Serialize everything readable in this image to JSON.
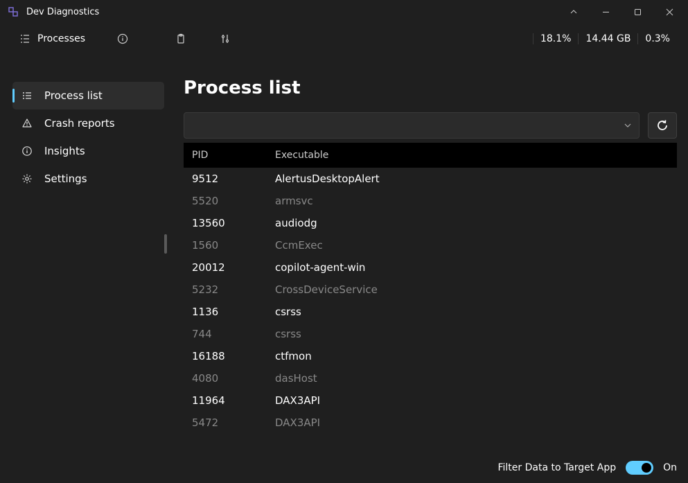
{
  "window": {
    "title": "Dev Diagnostics"
  },
  "toolbar": {
    "processes_label": "Processes"
  },
  "stats": {
    "cpu": "18.1%",
    "memory": "14.44 GB",
    "other": "0.3%"
  },
  "sidebar": {
    "items": [
      {
        "label": "Process list",
        "icon": "list-icon",
        "active": true
      },
      {
        "label": "Crash reports",
        "icon": "warning-icon",
        "active": false
      },
      {
        "label": "Insights",
        "icon": "info-icon",
        "active": false
      },
      {
        "label": "Settings",
        "icon": "gear-icon",
        "active": false
      }
    ]
  },
  "main": {
    "title": "Process list",
    "search_value": "",
    "headers": {
      "pid": "PID",
      "exe": "Executable"
    },
    "rows": [
      {
        "pid": "9512",
        "exe": "AlertusDesktopAlert",
        "dim": false
      },
      {
        "pid": "5520",
        "exe": "armsvc",
        "dim": true
      },
      {
        "pid": "13560",
        "exe": "audiodg",
        "dim": false
      },
      {
        "pid": "1560",
        "exe": "CcmExec",
        "dim": true
      },
      {
        "pid": "20012",
        "exe": "copilot-agent-win",
        "dim": false
      },
      {
        "pid": "5232",
        "exe": "CrossDeviceService",
        "dim": true
      },
      {
        "pid": "1136",
        "exe": "csrss",
        "dim": false
      },
      {
        "pid": "744",
        "exe": "csrss",
        "dim": true
      },
      {
        "pid": "16188",
        "exe": "ctfmon",
        "dim": false
      },
      {
        "pid": "4080",
        "exe": "dasHost",
        "dim": true
      },
      {
        "pid": "11964",
        "exe": "DAX3API",
        "dim": false
      },
      {
        "pid": "5472",
        "exe": "DAX3API",
        "dim": true
      }
    ]
  },
  "footer": {
    "filter_label": "Filter Data to Target App",
    "toggle_state": "On"
  }
}
